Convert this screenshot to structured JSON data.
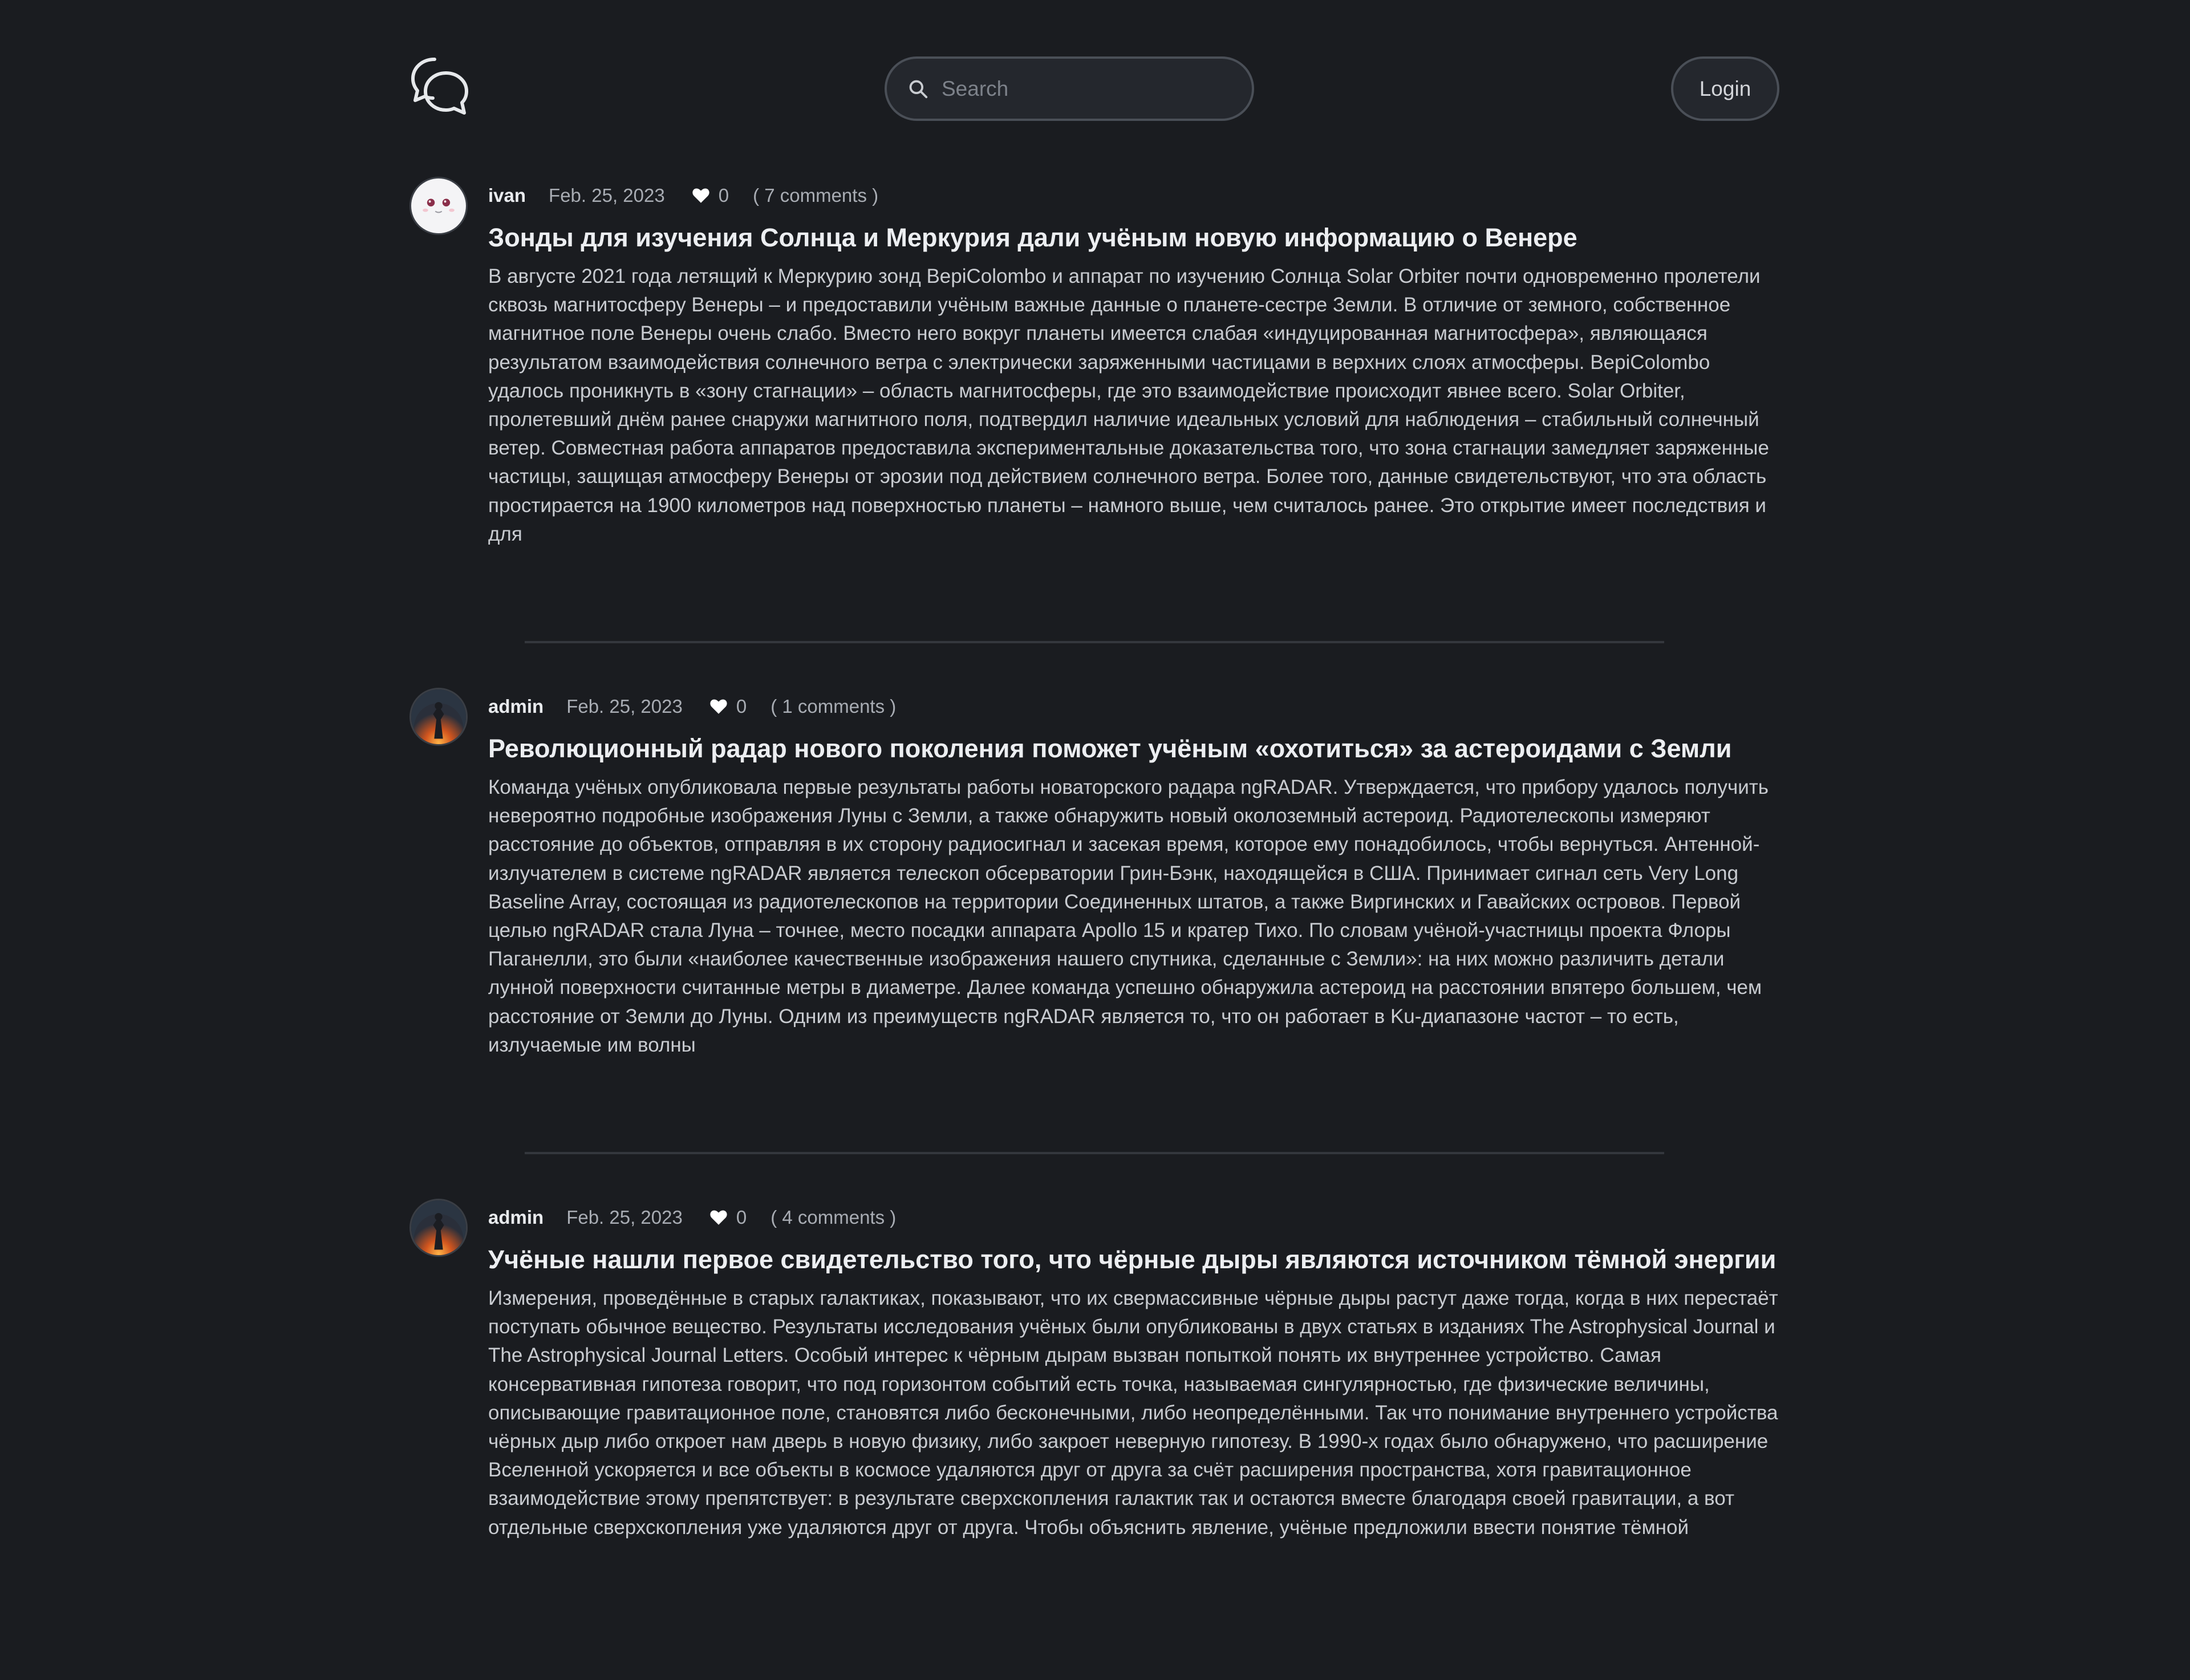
{
  "header": {
    "logo_icon": "chat-bubbles-icon",
    "search": {
      "placeholder": "Search",
      "value": ""
    },
    "login_label": "Login"
  },
  "posts": [
    {
      "author": "ivan",
      "avatar_icon": "cartoon-face-avatar",
      "date": "Feb. 25, 2023",
      "likes": "0",
      "comments": "( 7 comments )",
      "title": "Зонды для изучения Солнца и Меркурия дали учёным новую информацию о Венере",
      "excerpt": "В августе 2021 года летящий к Меркурию зонд BepiColombo и аппарат по изучению Солнца Solar Orbiter почти одновременно пролетели сквозь магнитосферу Венеры – и предоставили учёным важные данные о планете-сестре Земли. В отличие от земного, собственное магнитное поле Венеры очень слабо. Вместо него вокруг планеты имеется слабая «индуцированная магнитосфера», являющаяся результатом взаимодействия солнечного ветра с электрически заряженными частицами в верхних слоях атмосферы. BepiColombo удалось проникнуть в «зону стагнации» – область магнитосферы, где это взаимодействие происходит явнее всего. Solar Orbiter, пролетевший днём ранее снаружи магнитного поля, подтвердил наличие идеальных условий для наблюдения – стабильный солнечный ветер. Совместная работа аппаратов предоставила экспериментальные доказательства того, что зона стагнации замедляет заряженные частицы, защищая атмосферу Венеры от эрозии под действием солнечного ветра. Более того, данные свидетельствуют, что эта область простирается на 1900 километров над поверхностью планеты – намного выше, чем считалось ранее. Это открытие имеет последствия и для"
    },
    {
      "author": "admin",
      "avatar_icon": "fire-figure-avatar",
      "date": "Feb. 25, 2023",
      "likes": "0",
      "comments": "( 1 comments )",
      "title": "Революционный радар нового поколения поможет учёным «охотиться» за астероидами с Земли",
      "excerpt": "Команда учёных опубликовала первые результаты работы новаторского радара ngRADAR. Утверждается, что прибору удалось получить невероятно подробные изображения Луны с Земли, а также обнаружить новый околоземный астероид. Радиотелескопы измеряют расстояние до объектов, отправляя в их сторону радиосигнал и засекая время, которое ему понадобилось, чтобы вернуться. Антенной-излучателем в системе ngRADAR является телескоп обсерватории Грин-Бэнк, находящейся в США. Принимает сигнал сеть Very Long Baseline Array, состоящая из радиотелескопов на территории Соединенных штатов, а также Виргинских и Гавайских островов. Первой целью ngRADAR стала Луна – точнее, место посадки аппарата Apollo 15 и кратер Тихо. По словам учёной-участницы проекта Флоры Паганелли, это были «наиболее качественные изображения нашего спутника, сделанные с Земли»: на них можно различить детали лунной поверхности считанные метры в диаметре. Далее команда успешно обнаружила астероид на расстоянии впятеро большем, чем расстояние от Земли до Луны. Одним из преимуществ ngRADAR является то, что он работает в Ku-диапазоне частот – то есть, излучаемые им волны"
    },
    {
      "author": "admin",
      "avatar_icon": "fire-figure-avatar",
      "date": "Feb. 25, 2023",
      "likes": "0",
      "comments": "( 4 comments )",
      "title": "Учёные нашли первое свидетельство того, что чёрные дыры являются источником тёмной энергии",
      "excerpt": "Измерения, проведённые в старых галактиках, показывают, что их свермассивные чёрные дыры растут даже тогда, когда в них перестаёт поступать обычное вещество. Результаты исследования учёных были опубликованы в двух статьях в изданиях The Astrophysical Journal и The Astrophysical Journal Letters. Особый интерес к чёрным дырам вызван попыткой понять их внутреннее устройство. Самая консервативная гипотеза говорит, что под горизонтом событий есть точка, называемая сингулярностью, где физические величины, описывающие гравитационное поле, становятся либо бесконечными, либо неопределёнными. Так что понимание внутреннего устройства чёрных дыр либо откроет нам дверь в новую физику, либо закроет неверную гипотезу. В 1990-х годах было обнаружено, что расширение Вселенной ускоряется и все объекты в космосе удаляются друг от друга за счёт расширения пространства, хотя гравитационное взаимодействие этому препятствует: в результате сверхскопления галактик так и остаются вместе благодаря своей гравитации, а вот отдельные сверхскопления уже удаляются друг от друга. Чтобы объяснить явление, учёные предложили ввести понятие тёмной"
    }
  ],
  "colors": {
    "background": "#1a1c20",
    "surface": "#24272d",
    "border": "#4a4f57",
    "text": "#d4d6da",
    "title": "#eceef1",
    "muted": "#a8acb3"
  }
}
